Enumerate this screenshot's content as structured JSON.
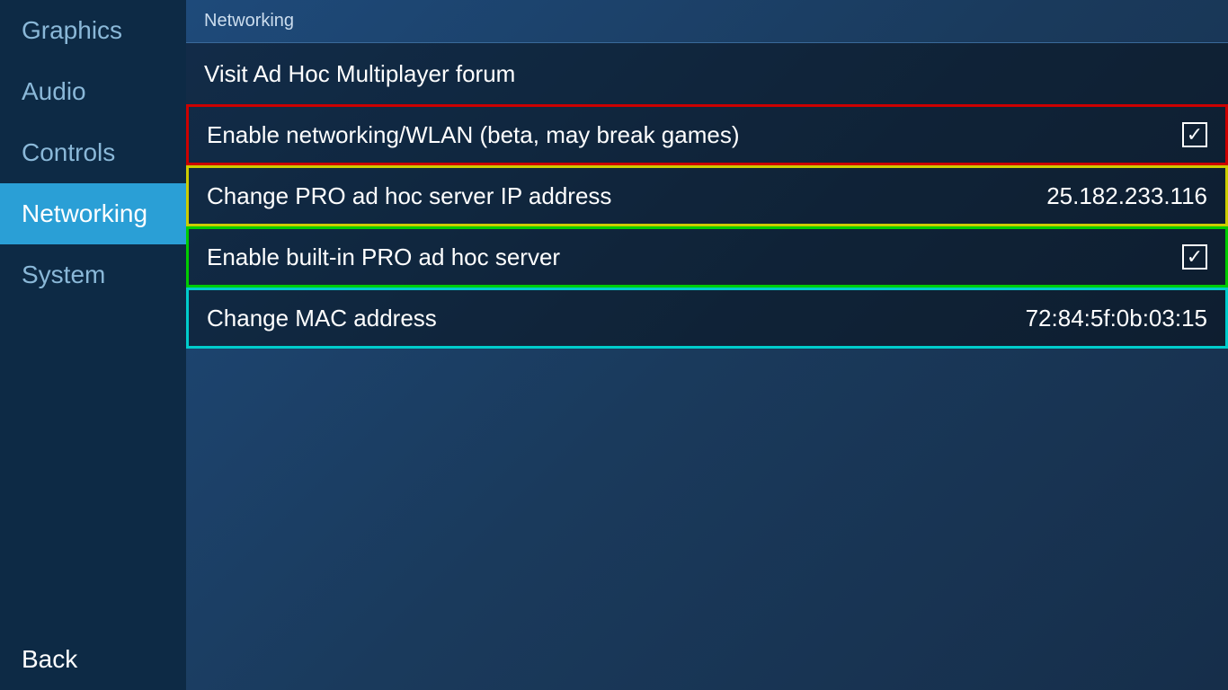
{
  "sidebar": {
    "items": [
      {
        "id": "graphics",
        "label": "Graphics",
        "active": false
      },
      {
        "id": "audio",
        "label": "Audio",
        "active": false
      },
      {
        "id": "controls",
        "label": "Controls",
        "active": false
      },
      {
        "id": "networking",
        "label": "Networking",
        "active": true
      },
      {
        "id": "system",
        "label": "System",
        "active": false
      }
    ],
    "back_label": "Back"
  },
  "main": {
    "section_title": "Networking",
    "menu_items": [
      {
        "id": "visit-adhoc",
        "label": "Visit Ad Hoc Multiplayer forum",
        "value": "",
        "border": "none",
        "checkbox": false
      },
      {
        "id": "enable-networking",
        "label": "Enable networking/WLAN (beta, may break games)",
        "value": "",
        "border": "red",
        "checkbox": true,
        "checked": true
      },
      {
        "id": "change-pro-ip",
        "label": "Change PRO ad hoc server IP address",
        "value": "25.182.233.116",
        "border": "yellow",
        "checkbox": false
      },
      {
        "id": "enable-builtin-pro",
        "label": "Enable built-in PRO ad hoc server",
        "value": "",
        "border": "green",
        "checkbox": true,
        "checked": true
      },
      {
        "id": "change-mac",
        "label": "Change MAC address",
        "value": "72:84:5f:0b:03:15",
        "border": "cyan",
        "checkbox": false
      }
    ]
  },
  "colors": {
    "red_border": "#cc0000",
    "yellow_border": "#cccc00",
    "green_border": "#00cc00",
    "cyan_border": "#00cccc"
  }
}
